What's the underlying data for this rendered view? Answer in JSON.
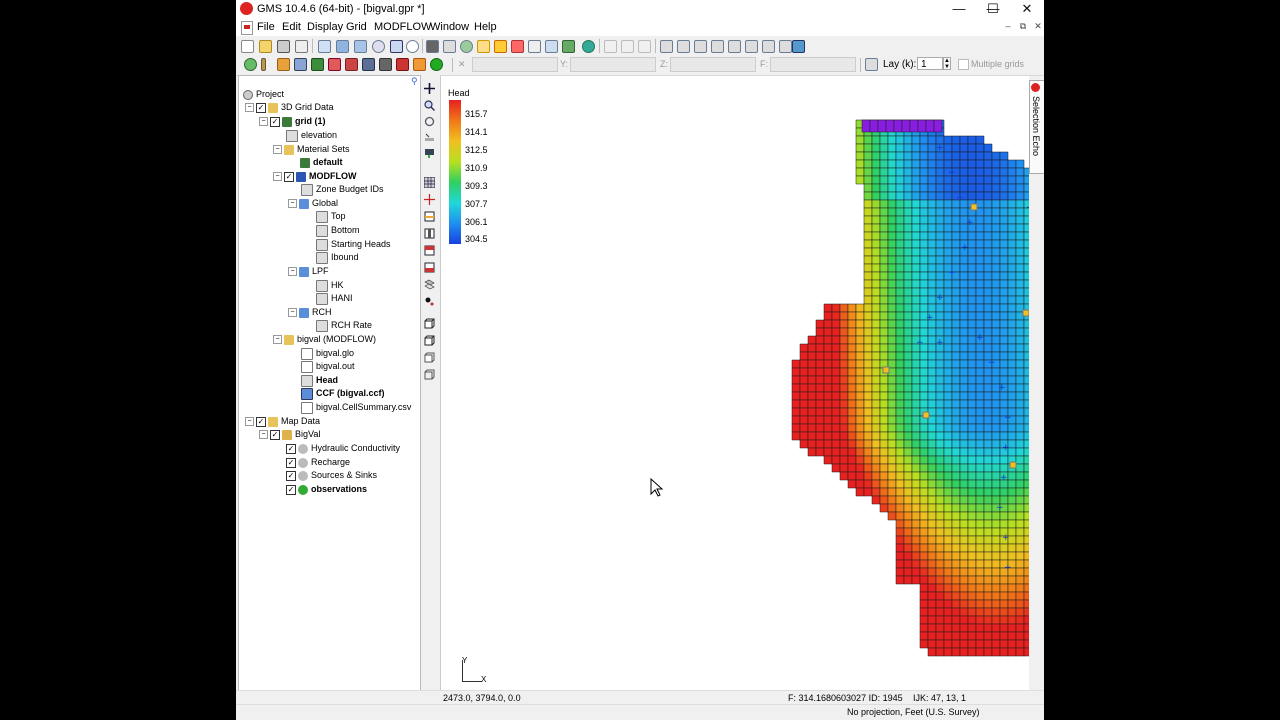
{
  "window": {
    "title": "GMS 10.4.6 (64-bit) - [bigval.gpr *]",
    "controls": {
      "minimize": "—",
      "maximize": "☐",
      "close": "✕"
    }
  },
  "menu": {
    "items": [
      "File",
      "Edit",
      "Display",
      "Grid",
      "MODFLOW",
      "Window",
      "Help"
    ],
    "mdi_controls": {
      "minimize": "–",
      "restore": "⧉",
      "close": "✕"
    }
  },
  "toolbar2": {
    "x_label": "X:",
    "y_label": "Y:",
    "z_label": "Z:",
    "f_label": "F:",
    "lay_label": "Lay (k):",
    "lay_value": "1",
    "multiple_grids_label": "Multiple grids"
  },
  "tree": {
    "project": "Project",
    "grid_data": "3D Grid Data",
    "grid": "grid (1)",
    "elevation": "elevation",
    "material_sets": "Material Sets",
    "default": "default",
    "modflow": "MODFLOW",
    "zone_budget": "Zone Budget IDs",
    "global": "Global",
    "top": "Top",
    "bottom": "Bottom",
    "starting_heads": "Starting Heads",
    "ibound": "Ibound",
    "lpf": "LPF",
    "hk": "HK",
    "hani": "HANI",
    "rch": "RCH",
    "rch_rate": "RCH Rate",
    "bigval_modflow": "bigval (MODFLOW)",
    "bigval_glo": "bigval.glo",
    "bigval_out": "bigval.out",
    "head": "Head",
    "ccf": "CCF (bigval.ccf)",
    "cellsummary": "bigval.CellSummary.csv",
    "map_data": "Map Data",
    "bigval_cov": "BigVal",
    "hydraulic": "Hydraulic Conductivity",
    "recharge": "Recharge",
    "sources": "Sources & Sinks",
    "observations": "observations"
  },
  "legend": {
    "title": "Head",
    "values": [
      "315.7",
      "314.1",
      "312.5",
      "310.9",
      "309.3",
      "307.7",
      "306.1",
      "304.5"
    ],
    "colors": [
      "#e82020",
      "#f07818",
      "#f0c020",
      "#b8e020",
      "#30d060",
      "#20d8d8",
      "#2090f0",
      "#1840e0"
    ]
  },
  "side_panel": {
    "selection_echo": "Selection Echo"
  },
  "axis_triad": {
    "y": "Y",
    "x": "X"
  },
  "status": {
    "coords": "2473.0, 3794.0, 0.0",
    "cell_info": "F: 314.1680603027 ID: 1945",
    "ijk": "IJK: 47, 13, 1",
    "projection": "No projection, Feet (U.S. Survey)"
  }
}
